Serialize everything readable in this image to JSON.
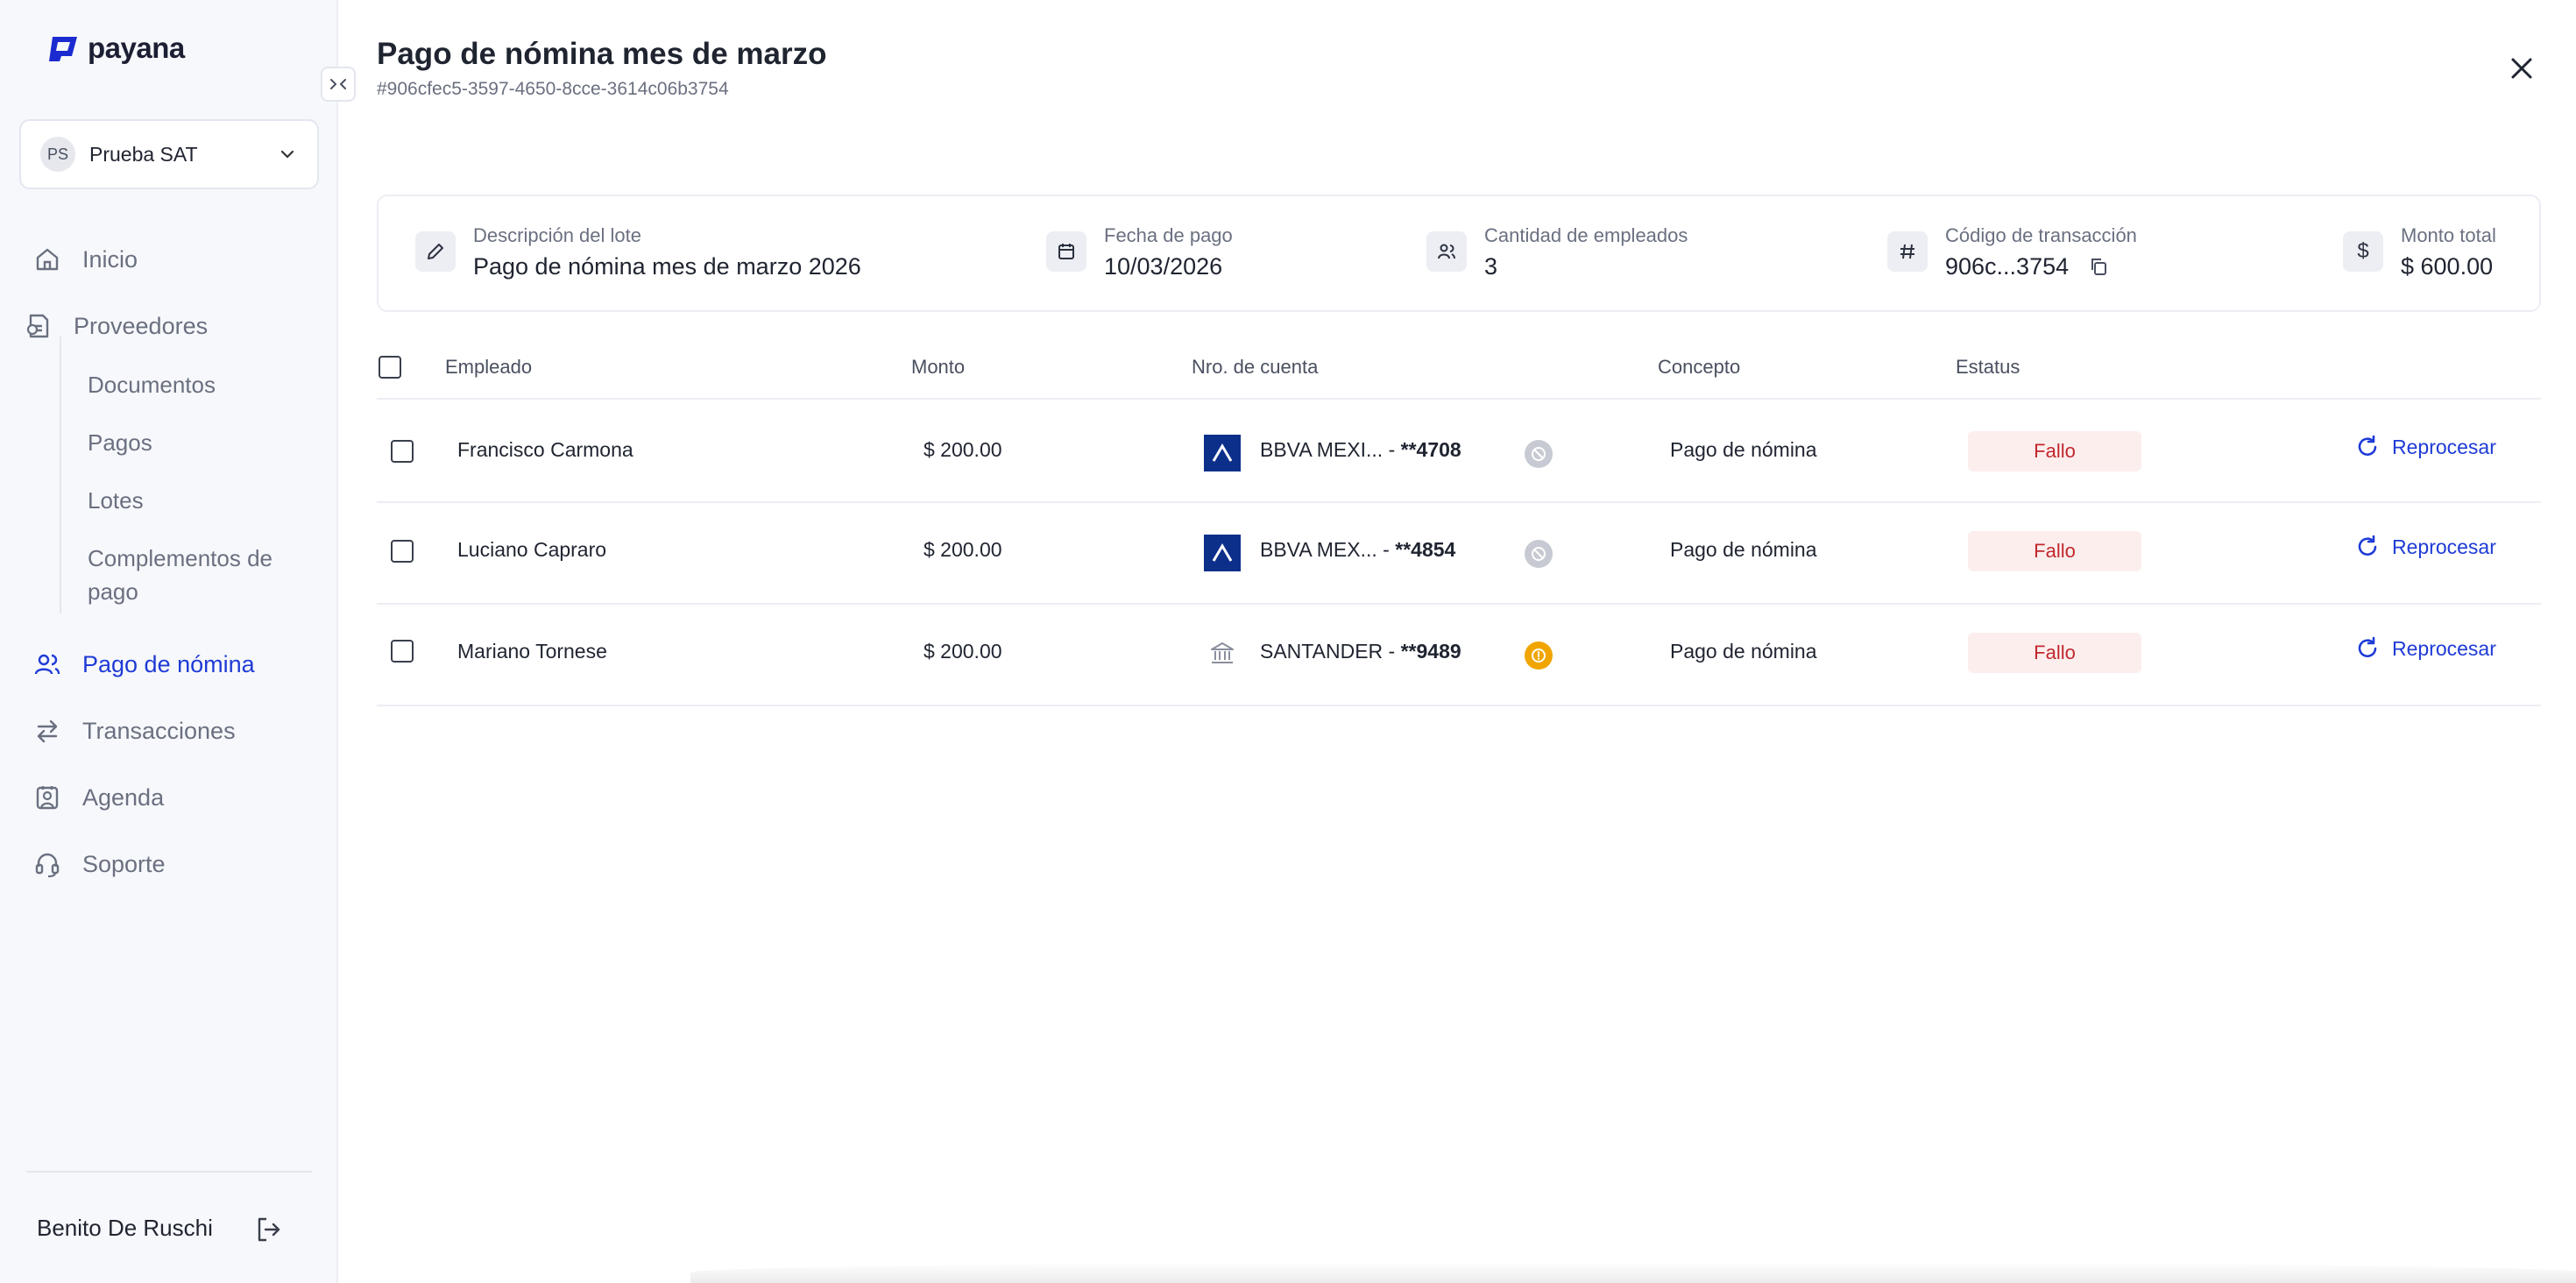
{
  "app": {
    "logo_text": "payana"
  },
  "company": {
    "initials": "PS",
    "name": "Prueba SAT"
  },
  "sidebar": {
    "items": [
      {
        "label": "Inicio",
        "icon": "home-icon"
      },
      {
        "label": "Proveedores",
        "icon": "invoice-icon"
      },
      {
        "label": "Pago de nómina",
        "icon": "users-icon"
      },
      {
        "label": "Transacciones",
        "icon": "arrows-icon"
      },
      {
        "label": "Agenda",
        "icon": "contacts-icon"
      },
      {
        "label": "Soporte",
        "icon": "headset-icon"
      }
    ],
    "sub_items": [
      "Documentos",
      "Pagos",
      "Lotes",
      "Complementos de pago"
    ],
    "active": "Pago de nómina",
    "user_name": "Benito De Ruschi",
    "colors": {
      "active": "#1f3bd6",
      "background": "#f7f8fb"
    }
  },
  "header": {
    "title": "Pago de nómina mes de marzo",
    "subtitle": "#906cfec5-3597-4650-8cce-3614c06b3754"
  },
  "summary": {
    "description_label": "Descripción del lote",
    "description_value": "Pago de nómina mes de marzo 2026",
    "date_label": "Fecha de pago",
    "date_value": "10/03/2026",
    "employees_label": "Cantidad de empleados",
    "employees_value": "3",
    "code_label": "Código de transacción",
    "code_value": "906c...3754",
    "total_label": "Monto total",
    "total_value": "$ 600.00"
  },
  "table": {
    "headers": [
      "Empleado",
      "Monto",
      "Nro. de cuenta",
      "Concepto",
      "Estatus"
    ],
    "rows": [
      {
        "employee": "Francisco Carmona",
        "amount": "$ 200.00",
        "bank": "BBVA MEXI...",
        "account": "**4708",
        "concept": "Pago de nómina",
        "status": "Fallo",
        "action": "Reprocesar",
        "bank_type": "bbva",
        "account_status": "blocked"
      },
      {
        "employee": "Luciano Capraro",
        "amount": "$ 200.00",
        "bank": "BBVA MEX...",
        "account": "**4854",
        "concept": "Pago de nómina",
        "status": "Fallo",
        "action": "Reprocesar",
        "bank_type": "bbva",
        "account_status": "blocked"
      },
      {
        "employee": "Mariano Tornese",
        "amount": "$ 200.00",
        "bank": "SANTANDER",
        "account": "**9489",
        "concept": "Pago de nómina",
        "status": "Fallo",
        "action": "Reprocesar",
        "bank_type": "generic",
        "account_status": "warning"
      }
    ]
  },
  "colors": {
    "accent": "#1f3bd6",
    "error_bg": "#fdeeee",
    "error_text": "#c0282d",
    "warning": "#f0a500"
  }
}
